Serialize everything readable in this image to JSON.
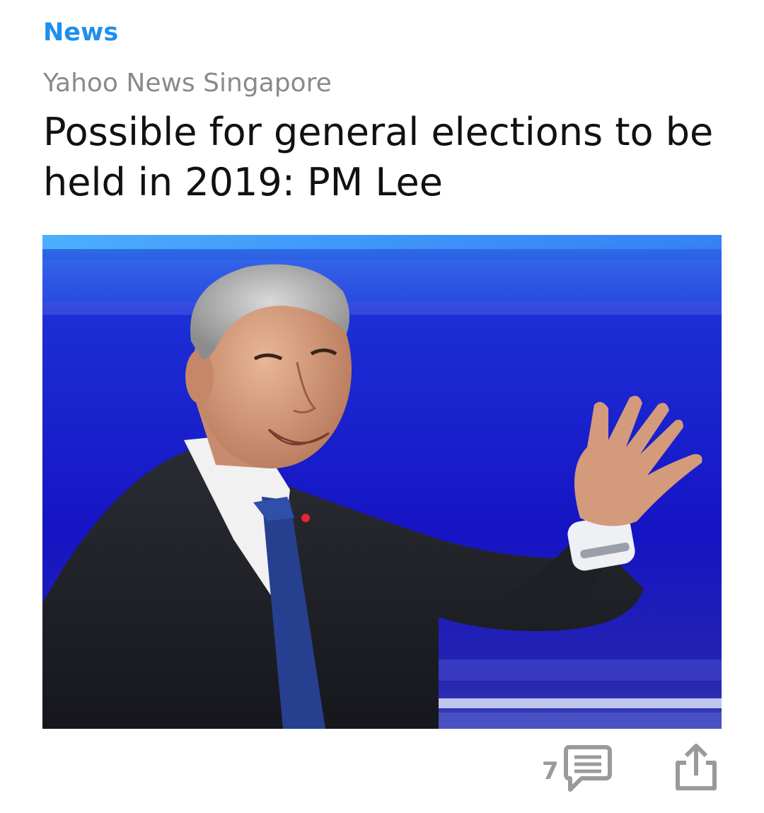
{
  "card": {
    "category": "News",
    "source": "Yahoo News Singapore",
    "headline": "Possible for general elections to be held in 2019: PM Lee"
  },
  "actions": {
    "comment_count": "7",
    "comment_icon": "comment-bubble-icon",
    "share_icon": "share-icon"
  },
  "colors": {
    "category": "#1f8fea",
    "source": "#8a8a8a",
    "headline": "#111111",
    "icon": "#9a9a9a"
  }
}
